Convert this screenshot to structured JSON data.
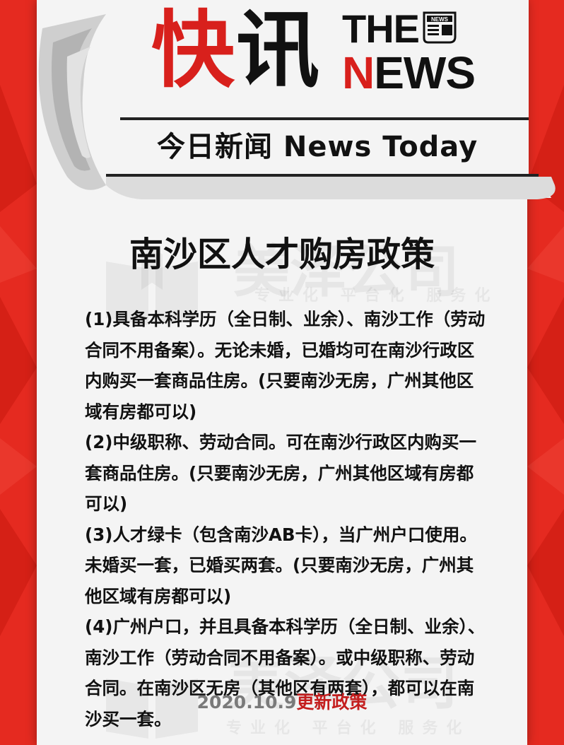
{
  "header": {
    "title_red": "快",
    "title_black": "讯",
    "the": "THE",
    "news_n": "N",
    "news_rest": "EWS",
    "icon_label": "NEWS",
    "today": "今日新闻 News Today"
  },
  "main": {
    "title": "南沙区人才购房政策",
    "paragraphs": [
      "(1)具备本科学历（全日制、业余）、南沙工作（劳动合同不用备案）。无论未婚，已婚均可在南沙行政区内购买一套商品住房。(只要南沙无房，广州其他区域有房都可以)",
      "(2)中级职称、劳动合同。可在南沙行政区内购买一套商品住房。(只要南沙无房，广州其他区域有房都可以)",
      "(3)人才绿卡（包含南沙AB卡），当广州户口使用。未婚买一套，已婚买两套。(只要南沙无房，广州其他区域有房都可以)",
      "(4)广州户口，并且具备本科学历（全日制、业余）、南沙工作（劳动合同不用备案）。或中级职称、劳动合同。在南沙区无房（其他区有两套），都可以在南沙买一套。"
    ],
    "date_prefix": "2020.10.9",
    "date_suffix": "更新政策"
  },
  "watermark": {
    "name": "美泽公司",
    "slogan": "专业化 平台化 服务化"
  },
  "colors": {
    "background": "#e52a20",
    "paper": "#f4f4f4",
    "accent_red": "#d8201c"
  }
}
